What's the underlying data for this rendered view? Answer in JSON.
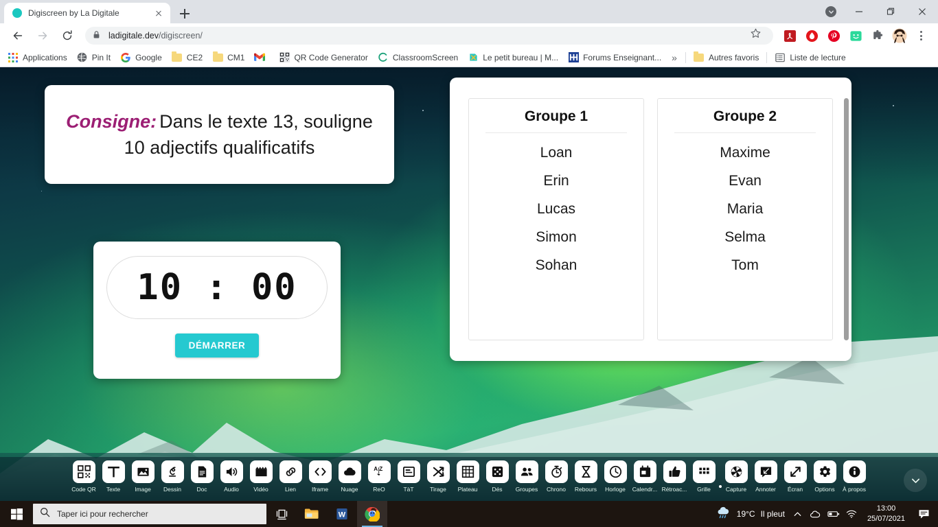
{
  "browser": {
    "tab": {
      "title": "Digiscreen by La Digitale",
      "favicon": "teal-circle-favicon",
      "close_icon": "close-icon"
    },
    "newtab_icon": "plus-icon",
    "window_controls": {
      "download_icon": "download-chevron-icon",
      "minimize": "minimize-icon",
      "maximize": "maximize-icon",
      "close": "close-icon"
    },
    "nav": {
      "back_icon": "back-arrow-icon",
      "forward_icon": "forward-arrow-icon",
      "reload_icon": "reload-icon"
    },
    "omnibox": {
      "lock_icon": "lock-icon",
      "domain": "ladigitale.dev",
      "path": "/digiscreen/",
      "star_icon": "bookmark-star-icon"
    },
    "extensions": [
      {
        "name": "adobe-acrobat-extension",
        "glyph": "A"
      },
      {
        "name": "opera-vpn-extension",
        "glyph": ""
      },
      {
        "name": "pinterest-extension",
        "glyph": "P"
      },
      {
        "name": "screencastify-extension",
        "glyph": ""
      },
      {
        "name": "extensions-puzzle-icon",
        "glyph": ""
      },
      {
        "name": "profile-avatar",
        "glyph": ""
      }
    ],
    "menu_icon": "kebab-menu-icon",
    "bookmarks": [
      {
        "label": "Applications",
        "icon": "apps-grid-icon"
      },
      {
        "label": "Pin It",
        "icon": "pinit-icon"
      },
      {
        "label": "Google",
        "icon": "google-g-icon"
      },
      {
        "label": "CE2",
        "icon": "folder-icon"
      },
      {
        "label": "CM1",
        "icon": "folder-icon"
      },
      {
        "label": "",
        "icon": "gmail-icon"
      },
      {
        "label": "QR Code Generator",
        "icon": "qr-code-icon"
      },
      {
        "label": "ClassroomScreen",
        "icon": "classroomscreen-icon"
      },
      {
        "label": "Le petit bureau | M...",
        "icon": "petit-bureau-icon"
      },
      {
        "label": "Forums Enseignant...",
        "icon": "forums-icon"
      }
    ],
    "bookmarks_overflow": "»",
    "other_bookmarks": {
      "label": "Autres favoris",
      "icon": "folder-icon"
    },
    "reading_list": {
      "label": "Liste de lecture",
      "icon": "reading-list-icon"
    }
  },
  "consigne": {
    "label": "Consigne:",
    "text": "Dans le texte 13, souligne 10 adjectifs qualificatifs",
    "label_color": "#9c1f74"
  },
  "timer": {
    "value": "10 : 00",
    "minutes": "10",
    "seconds": "00",
    "start_label": "DÉMARRER",
    "accent_color": "#25c9d0"
  },
  "groups": [
    {
      "title": "Groupe 1",
      "members": [
        "Loan",
        "Erin",
        "Lucas",
        "Simon",
        "Sohan"
      ]
    },
    {
      "title": "Groupe 2",
      "members": [
        "Maxime",
        "Evan",
        "Maria",
        "Selma",
        "Tom"
      ]
    }
  ],
  "dock": {
    "items": [
      {
        "label": "Code QR",
        "icon": "qr-code-icon"
      },
      {
        "label": "Texte",
        "icon": "text-t-icon"
      },
      {
        "label": "Image",
        "icon": "image-icon"
      },
      {
        "label": "Dessin",
        "icon": "drawing-scribble-icon"
      },
      {
        "label": "Doc",
        "icon": "document-icon"
      },
      {
        "label": "Audio",
        "icon": "speaker-icon"
      },
      {
        "label": "Vidéo",
        "icon": "clapperboard-icon"
      },
      {
        "label": "Lien",
        "icon": "link-chain-icon"
      },
      {
        "label": "Iframe",
        "icon": "code-brackets-icon"
      },
      {
        "label": "Nuage",
        "icon": "cloud-icon"
      },
      {
        "label": "ReO",
        "icon": "sort-az-icon"
      },
      {
        "label": "TàT",
        "icon": "window-panel-icon"
      },
      {
        "label": "Tirage",
        "icon": "shuffle-icon"
      },
      {
        "label": "Plateau",
        "icon": "grid-board-icon"
      },
      {
        "label": "Dés",
        "icon": "dice-icon"
      },
      {
        "label": "Groupes",
        "icon": "people-group-icon"
      },
      {
        "label": "Chrono",
        "icon": "stopwatch-icon"
      },
      {
        "label": "Rebours",
        "icon": "hourglass-icon"
      },
      {
        "label": "Horloge",
        "icon": "clock-icon"
      },
      {
        "label": "Calendr...",
        "icon": "calendar-icon"
      },
      {
        "label": "Rétroac...",
        "icon": "thumbs-up-icon"
      },
      {
        "label": "Grille",
        "icon": "grid-icon"
      },
      {
        "label": "Capture",
        "icon": "camera-shutter-icon"
      },
      {
        "label": "Annoter",
        "icon": "annotate-icon"
      },
      {
        "label": "Écran",
        "icon": "fullscreen-arrows-icon"
      },
      {
        "label": "Options",
        "icon": "gear-icon"
      },
      {
        "label": "À propos",
        "icon": "info-icon"
      }
    ],
    "collapse_icon": "chevron-down-icon"
  },
  "taskbar": {
    "start_icon": "windows-start-icon",
    "search": {
      "placeholder": "Taper ici pour rechercher",
      "icon": "search-icon"
    },
    "pinned": [
      {
        "name": "task-view-icon",
        "label": ""
      },
      {
        "name": "file-explorer-icon",
        "label": ""
      },
      {
        "name": "word-icon",
        "label": "W"
      },
      {
        "name": "chrome-icon",
        "label": ""
      }
    ],
    "tray": {
      "weather_icon": "rain-cloud-icon",
      "temperature": "19°C",
      "condition": "Il pleut",
      "chevron_icon": "chevron-up-icon",
      "icons": [
        "onedrive-icon",
        "battery-icon",
        "wifi-icon"
      ],
      "time": "13:00",
      "date": "25/07/2021",
      "notification_icon": "notification-icon"
    }
  }
}
